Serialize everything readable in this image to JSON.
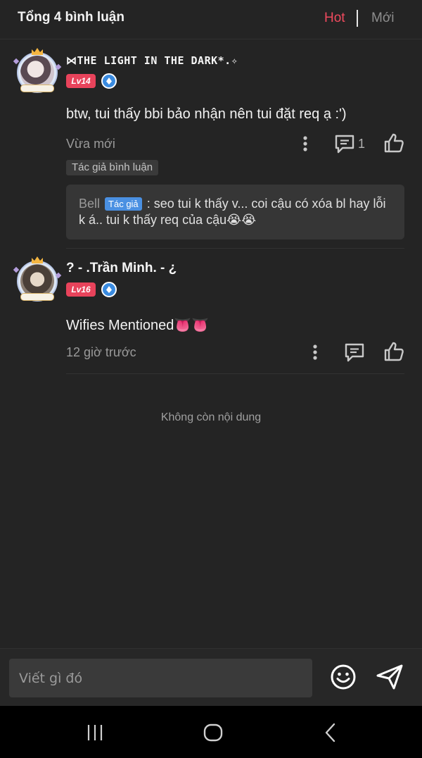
{
  "header": {
    "title": "Tổng 4 bình luận",
    "sort_hot": "Hot",
    "sort_new": "Mới",
    "active_sort": "Hot",
    "accent_color": "#f04a5e"
  },
  "comments": [
    {
      "username": "⋈THE LIGHT IN THE DARK*.✧",
      "level": "Lv14",
      "text": "btw, tui thấy bbi bảo nhận nên tui đặt req ạ :')",
      "time": "Vừa mới",
      "reply_count": "1",
      "author_tag": "Tác giả bình luận",
      "reply": {
        "name": "Bell",
        "tag": "Tác giả",
        "line1": ": seo tui k thấy v... coi cậu có xóa bl hay lỗi",
        "line2": "k á.. tui k thấy req của cậu😭😭"
      }
    },
    {
      "username": "? - .Trần Minh. - ¿",
      "level": "Lv16",
      "text": "Wifies Mentioned👅👅",
      "time": "12 giờ trước"
    }
  ],
  "end_text": "Không còn nội dung",
  "composer": {
    "placeholder": "Viết gì đó"
  },
  "icons": {
    "more": "more-vertical-icon",
    "reply": "comment-icon",
    "like": "thumbs-up-icon",
    "emoji": "smiley-icon",
    "send": "send-icon",
    "nav_recent": "recent-apps-icon",
    "nav_home": "home-icon",
    "nav_back": "back-icon"
  }
}
